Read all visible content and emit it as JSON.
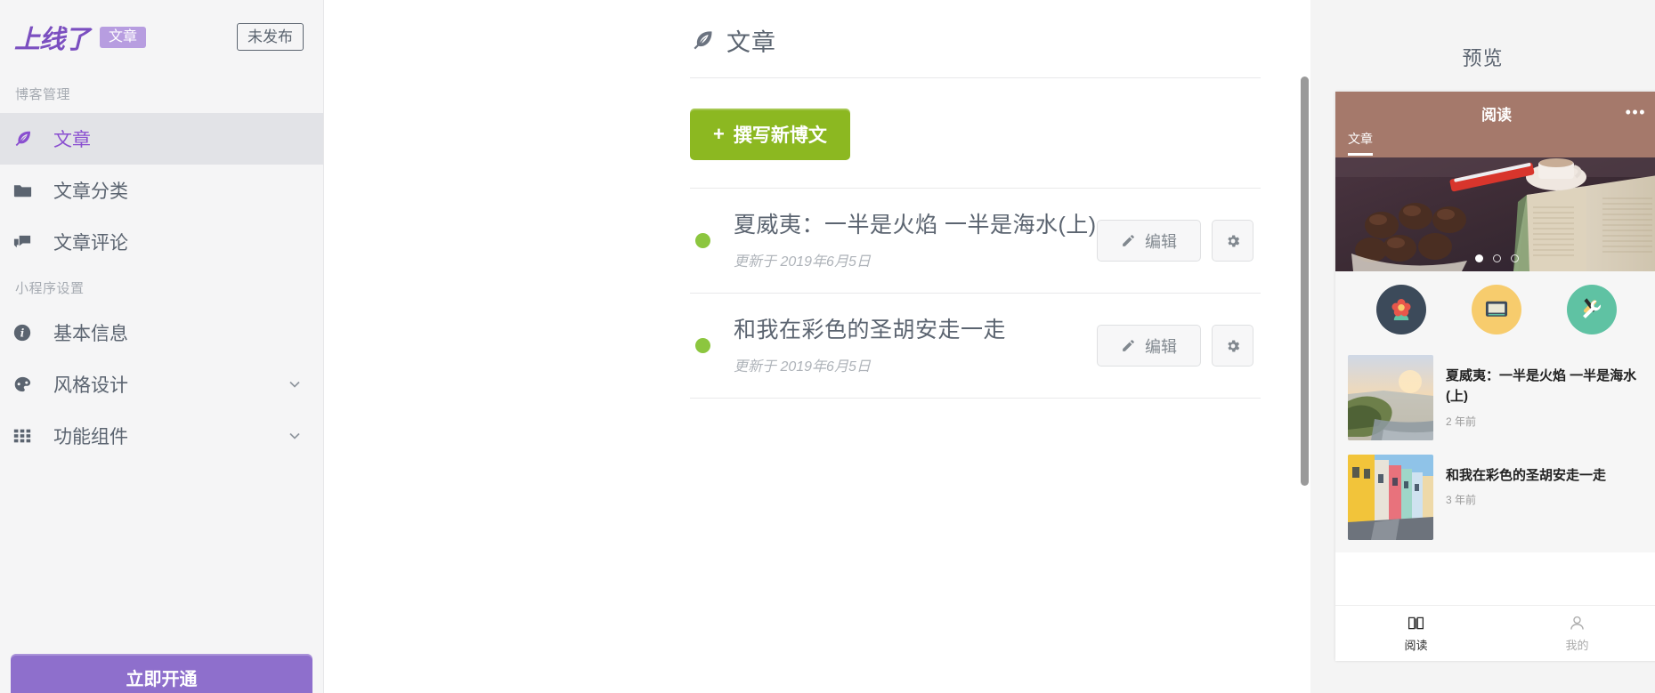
{
  "sidebar": {
    "brand": "上线了",
    "brand_chip": "文章",
    "publish_status": "未发布",
    "groups": [
      {
        "label": "博客管理",
        "items": [
          {
            "label": "文章",
            "icon": "feather-icon",
            "active": true,
            "chevron": false
          },
          {
            "label": "文章分类",
            "icon": "folder-icon",
            "active": false,
            "chevron": false
          },
          {
            "label": "文章评论",
            "icon": "comments-icon",
            "active": false,
            "chevron": false
          }
        ]
      },
      {
        "label": "小程序设置",
        "items": [
          {
            "label": "基本信息",
            "icon": "info-icon",
            "active": false,
            "chevron": false
          },
          {
            "label": "风格设计",
            "icon": "palette-icon",
            "active": false,
            "chevron": true
          },
          {
            "label": "功能组件",
            "icon": "grid-icon",
            "active": false,
            "chevron": true
          }
        ]
      }
    ],
    "bottom_button": "立即开通"
  },
  "main": {
    "page_title": "文章",
    "page_title_icon": "feather-icon",
    "new_post_button": "撰写新博文",
    "new_post_plus": "+",
    "posts": [
      {
        "title": "夏威夷：一半是火焰 一半是海水(上)",
        "subtitle": "更新于 2019年6月5日",
        "status_color": "#8cc63f",
        "edit_label": "编辑",
        "gear_label": "设置"
      },
      {
        "title": "和我在彩色的圣胡安走一走",
        "subtitle": "更新于 2019年6月5日",
        "status_color": "#8cc63f",
        "edit_label": "编辑",
        "gear_label": "设置"
      }
    ]
  },
  "preview": {
    "title": "预览",
    "phone": {
      "nav_title": "阅读",
      "nav_more": "•••",
      "tab": "文章",
      "nav_bg": "#a5796b",
      "carousel_dots": 3,
      "carousel_active": 0,
      "shortcuts": [
        {
          "name": "flower-icon",
          "bg": "#3c4a5a"
        },
        {
          "name": "monitor-icon",
          "bg": "#f7cc6d"
        },
        {
          "name": "tools-icon",
          "bg": "#5fc2a3"
        }
      ],
      "articles": [
        {
          "title": "夏威夷：一半是火焰 一半是海水(上)",
          "date": "2 年前",
          "thumb": "coastline-photo"
        },
        {
          "title": "和我在彩色的圣胡安走一走",
          "date": "3 年前",
          "thumb": "colorful-street-photo"
        }
      ],
      "tabbar": [
        {
          "label": "阅读",
          "icon": "book-icon",
          "active": true
        },
        {
          "label": "我的",
          "icon": "person-icon",
          "active": false
        }
      ]
    }
  }
}
